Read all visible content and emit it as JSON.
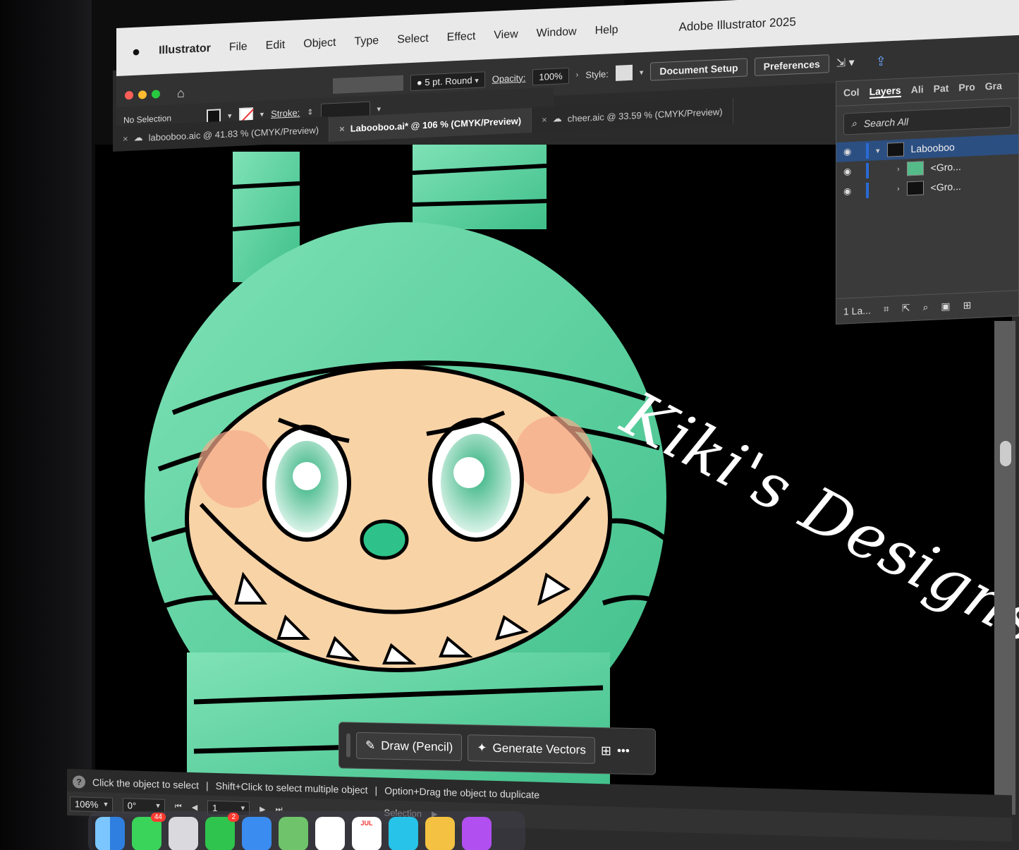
{
  "menubar": {
    "app_name": "Illustrator",
    "items": [
      "File",
      "Edit",
      "Object",
      "Type",
      "Select",
      "Effect",
      "View",
      "Window",
      "Help"
    ],
    "window_title": "Adobe Illustrator 2025"
  },
  "control_bar": {
    "stroke_label": "Stroke:",
    "brush": "5 pt. Round",
    "opacity_label": "Opacity:",
    "opacity_value": "100%",
    "style_label": "Style:",
    "document_setup": "Document Setup",
    "preferences": "Preferences",
    "selection_state": "No Selection"
  },
  "tabs": [
    {
      "label": "labooboo.aic @ 41.83 % (CMYK/Preview)"
    },
    {
      "label": "Labooboo.ai* @ 106 % (CMYK/Preview)"
    },
    {
      "label": "cheer.aic @ 33.59 % (CMYK/Preview)"
    }
  ],
  "canvas": {
    "script_text": "Kiki's Designs"
  },
  "layers_panel": {
    "tabs": [
      "Col",
      "Layers",
      "Ali",
      "Pat",
      "Pro",
      "Gra"
    ],
    "search_placeholder": "Search All",
    "rows": [
      {
        "name": "Labooboo"
      },
      {
        "name": "<Gro..."
      },
      {
        "name": "<Gro..."
      }
    ],
    "footer_count": "1 La..."
  },
  "task_bar": {
    "draw": "Draw (Pencil)",
    "generate": "Generate Vectors",
    "more": "•••"
  },
  "hint_bar": {
    "hint1": "Click the object to select",
    "hint2": "Shift+Click to select multiple object",
    "hint3": "Option+Drag the object to duplicate"
  },
  "status_bar": {
    "zoom": "106%",
    "rotation": "0°",
    "artboard": "1",
    "mode": "Selection"
  },
  "dock": {
    "messages_badge": "44",
    "facetime_badge": "2",
    "calendar_month": "JUL"
  }
}
